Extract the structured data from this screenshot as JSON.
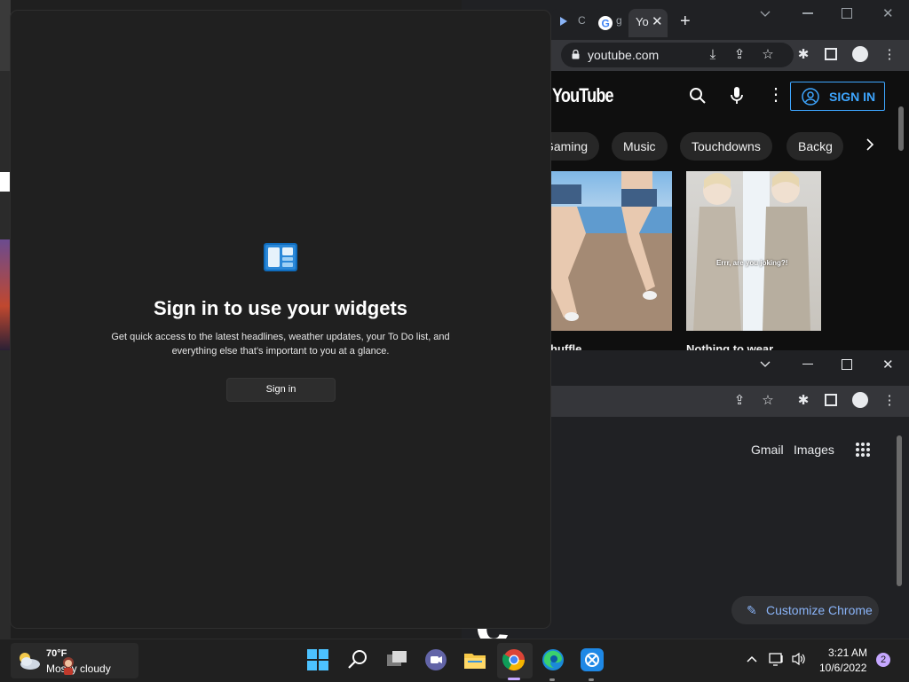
{
  "yt_window": {
    "url": "youtube.com",
    "tabs": [
      {
        "label": "C",
        "icon": "play-favicon-icon"
      },
      {
        "label": "g",
        "icon": "google-favicon-icon"
      },
      {
        "label": "Yo",
        "icon": "youtube-favicon-icon"
      }
    ],
    "new_tab": "+",
    "logo": "YouTube",
    "sign_in": "SIGN IN",
    "chips": [
      "Gaming",
      "Music",
      "Touchdowns",
      "Backg"
    ],
    "videos": [
      {
        "title": "huffle",
        "overlay": ""
      },
      {
        "title": "Nothing to wear",
        "overlay": "Errr, are you joking?!"
      }
    ]
  },
  "google_window": {
    "links": [
      "Gmail",
      "Images"
    ],
    "customize": "Customize Chrome",
    "logo_fragment": "e"
  },
  "widgets": {
    "title": "Sign in to use your widgets",
    "description_line1": "Get quick access to the latest headlines, weather updates, your To Do list, and",
    "description_line2": "everything else that's important to you at a glance.",
    "sign_in": "Sign in"
  },
  "taskbar": {
    "weather_temp": "70°F",
    "weather_desc": "Mostly cloudy",
    "time": "3:21 AM",
    "date": "10/6/2022",
    "notification_count": "2",
    "apps": [
      "windows-start-icon",
      "search-icon",
      "task-view-icon",
      "teams-chat-icon",
      "file-explorer-icon",
      "chrome-icon",
      "edge-icon",
      "app-icon"
    ]
  },
  "colors": {
    "accent_blue": "#3ea6ff",
    "link_blue": "#8ab4f8",
    "badge_purple": "#c5a7ff"
  }
}
